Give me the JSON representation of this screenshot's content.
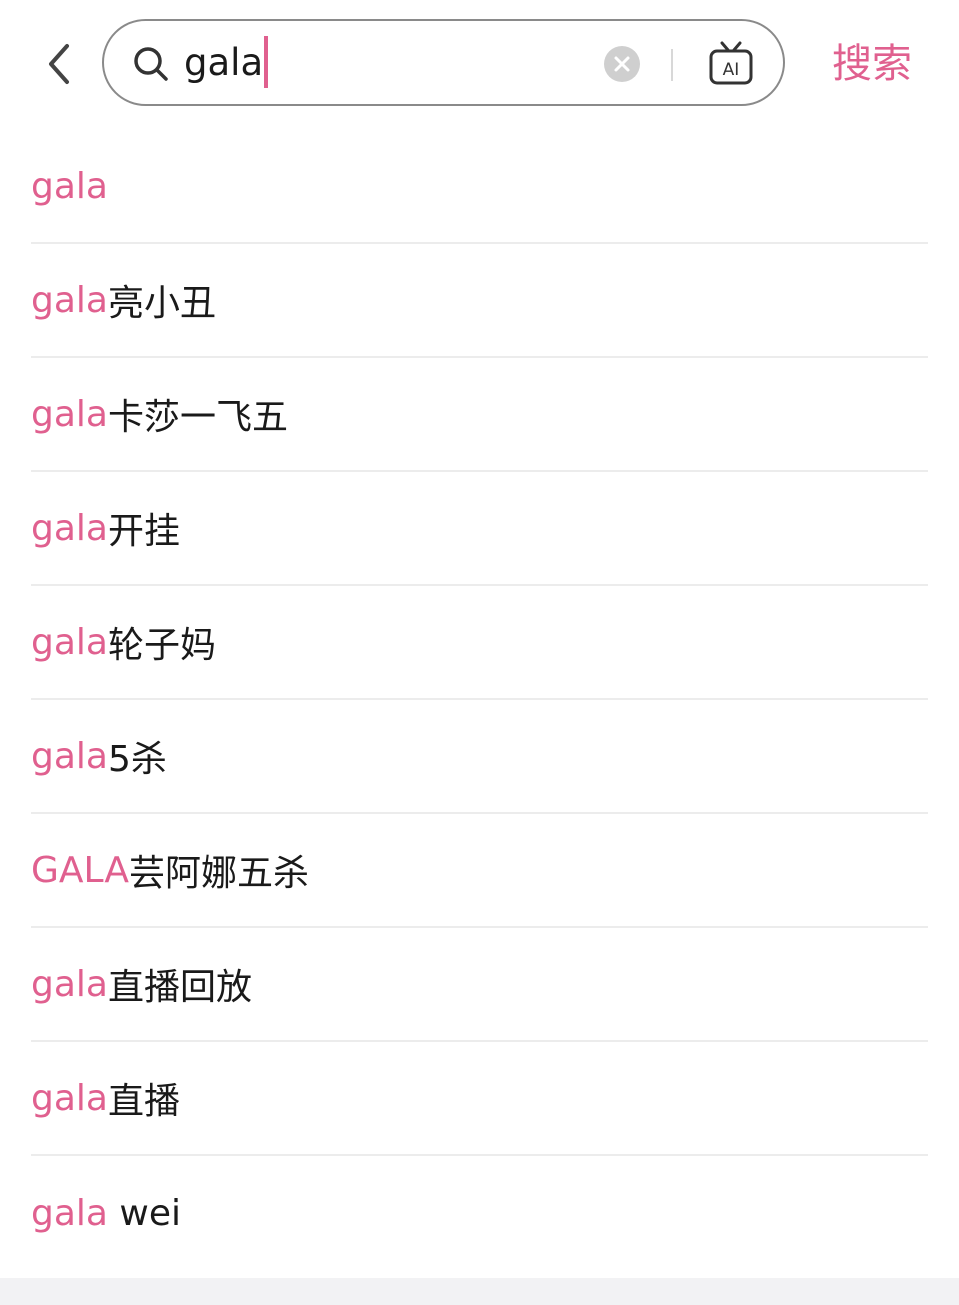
{
  "colors": {
    "accent": "#e0608f",
    "text": "#1a1a1a",
    "border": "#8a8a8a",
    "divider": "#ececec"
  },
  "header": {
    "back_icon": "chevron-left-icon",
    "search": {
      "icon": "search-icon",
      "value": "gala",
      "clear_icon": "clear-circle-icon",
      "ai_icon": "ai-tv-icon",
      "ai_label": "AI"
    },
    "submit_label": "搜索"
  },
  "suggestions": [
    {
      "highlight": "gala",
      "rest": ""
    },
    {
      "highlight": "gala",
      "rest": "亮小丑"
    },
    {
      "highlight": "gala",
      "rest": "卡莎一飞五"
    },
    {
      "highlight": "gala",
      "rest": "开挂"
    },
    {
      "highlight": "gala",
      "rest": "轮子妈"
    },
    {
      "highlight": "gala",
      "rest": "5杀"
    },
    {
      "highlight": "GALA",
      "rest": "芸阿娜五杀"
    },
    {
      "highlight": "gala",
      "rest": "直播回放"
    },
    {
      "highlight": "gala",
      "rest": "直播"
    },
    {
      "highlight": "gala",
      "rest": " wei"
    }
  ]
}
